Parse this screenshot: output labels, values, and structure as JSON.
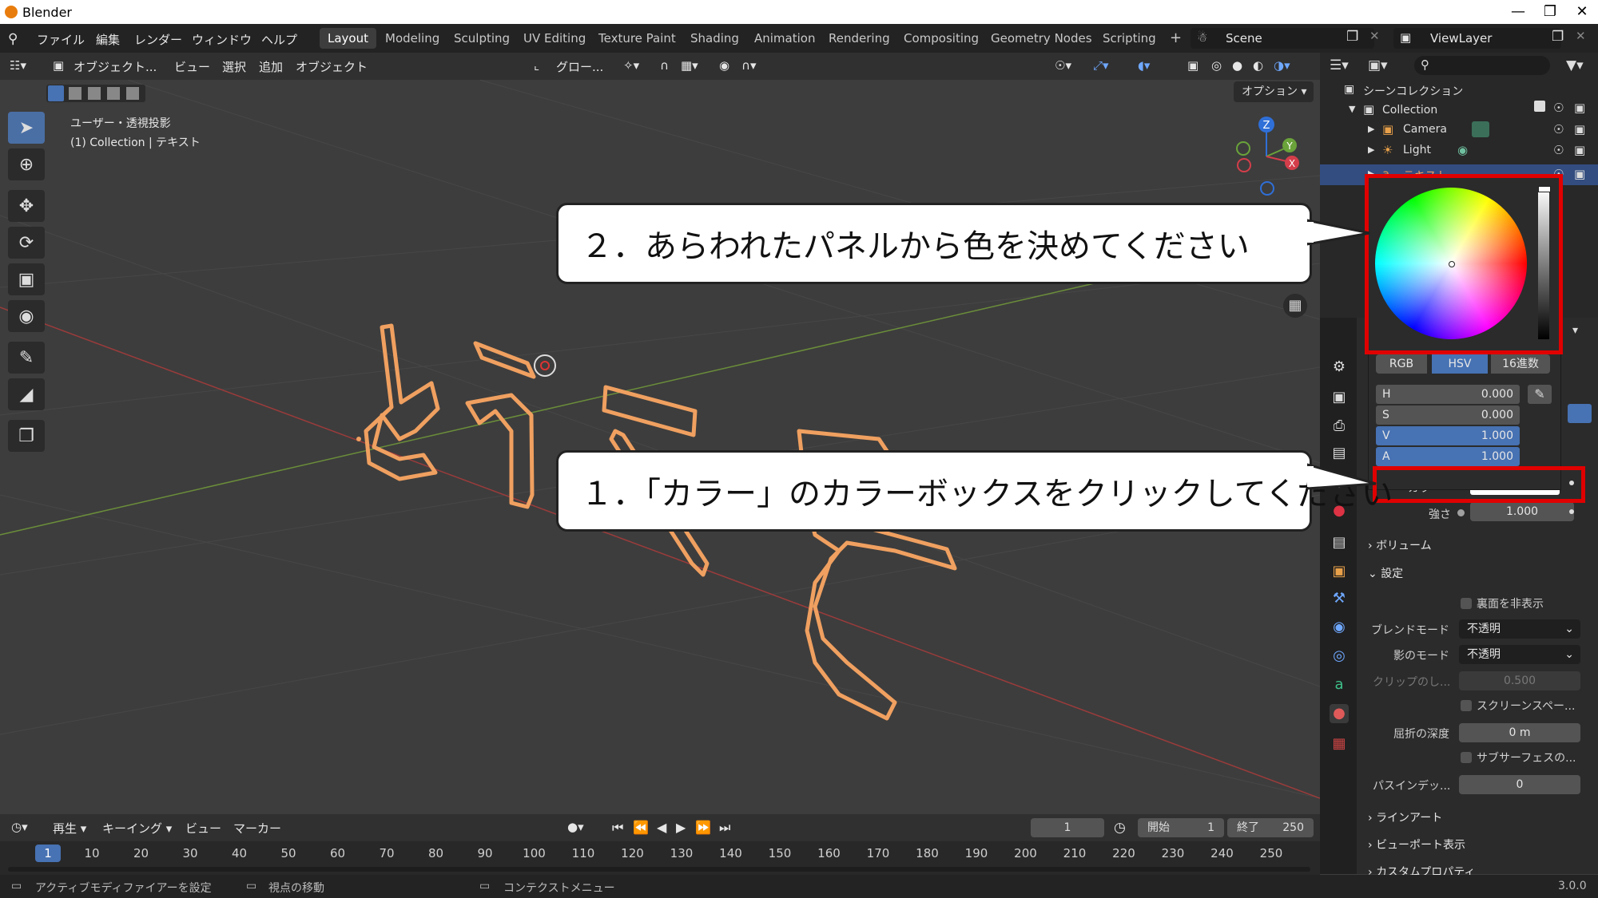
{
  "app": {
    "title": "Blender",
    "version": "3.0.0"
  },
  "menu": {
    "items": [
      "ファイル",
      "編集",
      "レンダー",
      "ウィンドウ",
      "ヘルプ"
    ]
  },
  "workspaces": {
    "tabs": [
      "Layout",
      "Modeling",
      "Sculpting",
      "UV Editing",
      "Texture Paint",
      "Shading",
      "Animation",
      "Rendering",
      "Compositing",
      "Geometry Nodes",
      "Scripting"
    ],
    "active": "Layout",
    "add_label": "+"
  },
  "scene": {
    "name": "Scene",
    "view_layer": "ViewLayer"
  },
  "viewport_header": {
    "mode": "オブジェクト...",
    "view": "ビュー",
    "select": "選択",
    "add": "追加",
    "object": "オブジェクト",
    "transform": "グロー...",
    "options": "オプション"
  },
  "viewport": {
    "view_name": "ユーザー・透視投影",
    "context": "(1) Collection | テキスト",
    "text_object": "ようこそ"
  },
  "outliner": {
    "root": "シーンコレクション",
    "collection": "Collection",
    "items": [
      "Camera",
      "Light",
      "テキスト"
    ]
  },
  "color_picker": {
    "modes": [
      "RGB",
      "HSV",
      "16進数"
    ],
    "active_mode": "HSV",
    "fields": [
      {
        "key": "H",
        "value": "0.000"
      },
      {
        "key": "S",
        "value": "0.000"
      },
      {
        "key": "V",
        "value": "1.000"
      },
      {
        "key": "A",
        "value": "1.000"
      }
    ]
  },
  "properties": {
    "color_label": "カラー",
    "strength_label": "強さ",
    "strength_value": "1.000",
    "volume_section": "ボリューム",
    "settings_section": "設定",
    "backface_label": "裏面を非表示",
    "blend_mode_label": "ブレンドモード",
    "blend_mode_value": "不透明",
    "shadow_mode_label": "影のモード",
    "shadow_mode_value": "不透明",
    "clip_label": "クリップのし...",
    "clip_value": "0.500",
    "screen_space_label": "スクリーンスペー...",
    "refraction_label": "屈折の深度",
    "refraction_value": "0 m",
    "subsurface_label": "サブサーフェスの...",
    "pass_index_label": "パスインデッ...",
    "pass_index_value": "0",
    "lineart_section": "ラインアート",
    "viewport_display_section": "ビューポート表示",
    "custom_props_section": "カスタムプロパティ"
  },
  "timeline": {
    "playback": "再生",
    "keying": "キーイング",
    "view": "ビュー",
    "marker": "マーカー",
    "current_frame": "1",
    "start_label": "開始",
    "start": "1",
    "end_label": "終了",
    "end": "250",
    "ticks": [
      "1",
      "10",
      "20",
      "30",
      "40",
      "50",
      "60",
      "70",
      "80",
      "90",
      "100",
      "110",
      "120",
      "130",
      "140",
      "150",
      "160",
      "170",
      "180",
      "190",
      "200",
      "210",
      "220",
      "230",
      "240",
      "250"
    ]
  },
  "status": {
    "left": "アクティブモディファイアーを設定",
    "middle": "視点の移動",
    "right": "コンテクストメニュー"
  },
  "callouts": {
    "step2": "２．あらわれたパネルから色を決めてください",
    "step1": "１．「カラー」のカラーボックスをクリックしてください"
  },
  "colors": {
    "accent": "#4772b3",
    "highlight_red": "#e00000",
    "text_outline": "#f0a060"
  }
}
